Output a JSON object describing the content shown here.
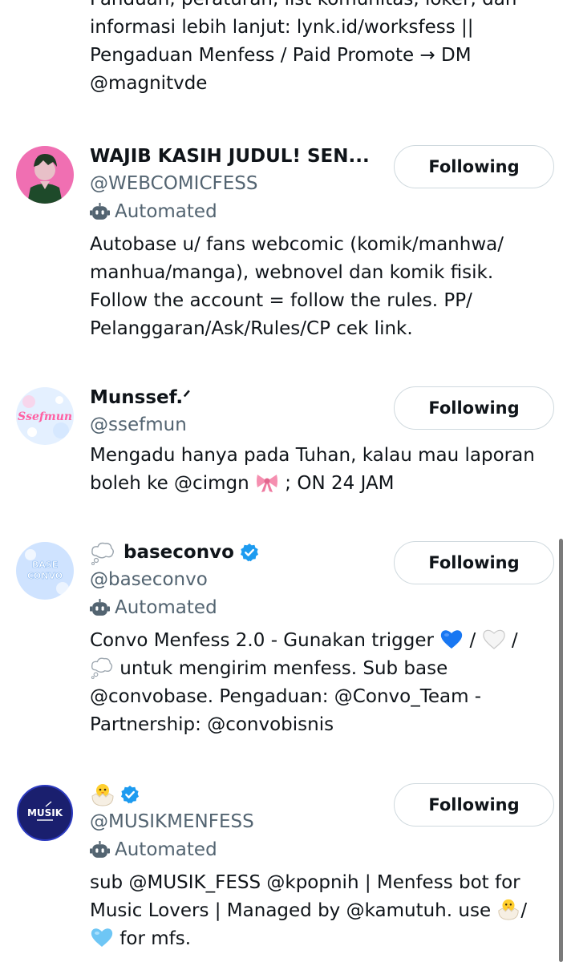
{
  "partial_bio": {
    "line0": "Panduan, peraturan, list komunitas, loker, dan",
    "line1": "informasi lebih lanjut: lynk.id/worksfess ||",
    "line2": "Pengaduan Menfess / Paid Promote → DM",
    "line3": "@magnitvde"
  },
  "accounts": [
    {
      "name": "WAJIB KASIH JUDUL! SEN...",
      "handle": "@WEBCOMICFESS",
      "automated_label": "Automated",
      "follow_label": "Following",
      "bio": "Autobase u/ fans webcomic (komik/manhwa/ manhua/manga), webnovel dan komik fisik. Follow the account = follow the rules. PP/ Pelanggaran/Ask/Rules/CP cek link."
    },
    {
      "name": "Munssef.ᐟ",
      "handle": "@ssefmun",
      "follow_label": "Following",
      "avatar_text": "Ssefmun",
      "bio_a": "Mengadu hanya pada Tuhan, kalau mau laporan boleh ke @cimgn ",
      "bio_b": " ; ON 24 JAM"
    },
    {
      "name": "baseconvo",
      "handle": "@baseconvo",
      "automated_label": "Automated",
      "follow_label": "Following",
      "avatar_text_top": "BASE",
      "avatar_text_bottom": "CONVO",
      "bio_a": "Convo Menfess 2.0 - Gunakan trigger ",
      "bio_b": " / ",
      "bio_c": " / ",
      "bio_d": " untuk mengirim menfess. Sub base @convobase. Pengaduan: @Convo_Team - Partnership: @convobisnis"
    },
    {
      "handle": "@MUSIKMENFESS",
      "automated_label": "Automated",
      "follow_label": "Following",
      "avatar_text": "MUSIK",
      "bio_a": "sub @MUSIK_FESS @kpopnih | Menfess bot for Music Lovers | Managed by @kamutuh. use ",
      "bio_b": "/",
      "bio_c": " for mfs."
    }
  ],
  "icons": {
    "bot": "robot-icon",
    "verified": "verified-badge-icon",
    "bow": "ribbon-emoji",
    "blue_heart": "blue-heart-emoji",
    "white_heart": "white-heart-emoji",
    "thought": "thought-balloon-emoji",
    "chick": "hatching-chick-emoji",
    "light_blue_heart": "light-blue-heart-emoji"
  },
  "colors": {
    "text_primary": "#0f1419",
    "text_secondary": "#536471",
    "button_border": "#cfd9de",
    "verified_blue": "#1d9bf0"
  }
}
